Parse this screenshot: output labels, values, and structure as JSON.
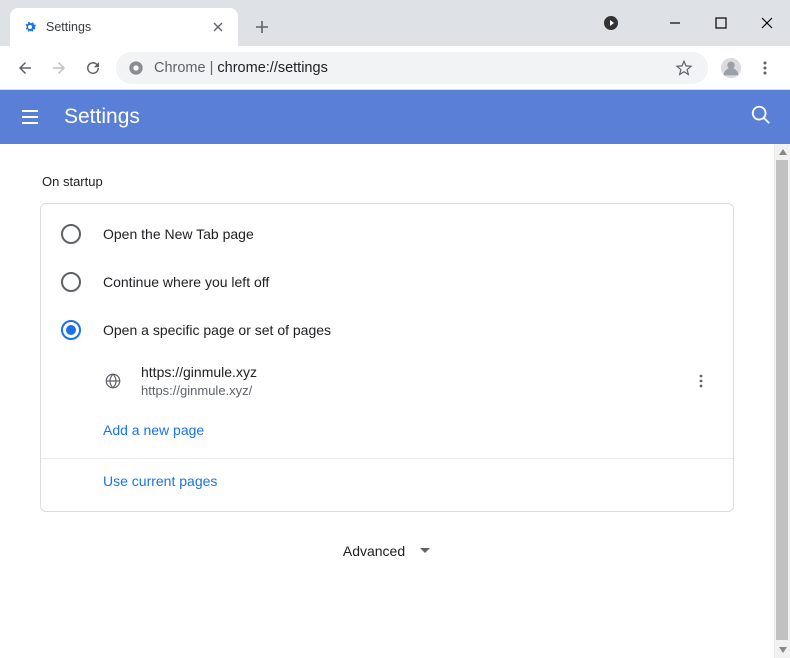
{
  "window": {
    "tab_title": "Settings"
  },
  "addressbar": {
    "origin": "Chrome",
    "path": "chrome://settings"
  },
  "header": {
    "title": "Settings"
  },
  "startup": {
    "section_title": "On startup",
    "options": {
      "new_tab": "Open the New Tab page",
      "continue": "Continue where you left off",
      "specific": "Open a specific page or set of pages"
    },
    "selected": "specific",
    "pages": [
      {
        "title": "https://ginmule.xyz",
        "url": "https://ginmule.xyz/"
      }
    ],
    "add_page_label": "Add a new page",
    "use_current_label": "Use current pages"
  },
  "advanced": {
    "label": "Advanced"
  }
}
